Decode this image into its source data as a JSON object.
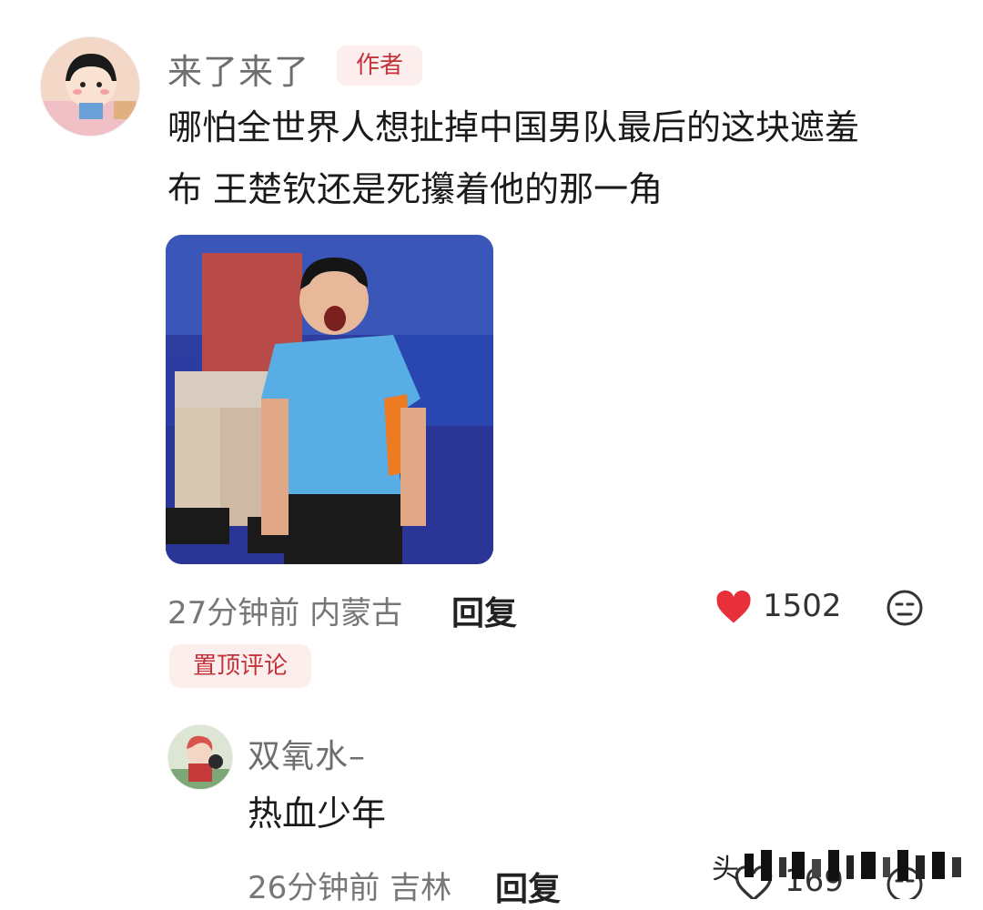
{
  "comment": {
    "username": "来了来了",
    "author_badge": "作者",
    "text_line1": "哪怕全世界人想扯掉中国男队最后的这块遮羞",
    "text_line2": "布 王楚钦还是死攥着他的那一角",
    "time_location": "27分钟前 内蒙古",
    "reply_label": "回复",
    "likes": "1502",
    "pinned_label": "置顶评论"
  },
  "reply_comment": {
    "username": "双氧水–",
    "text": "热血少年",
    "time_location": "26分钟前 吉林",
    "reply_label": "回复",
    "likes": "169"
  },
  "watermark": {
    "text": "头"
  },
  "icons": {
    "like": "heart-icon",
    "dislike": "meh-face-icon"
  },
  "colors": {
    "accent": "#c4323a",
    "badge_bg": "#fdeeee",
    "heart": "#e8303b"
  }
}
